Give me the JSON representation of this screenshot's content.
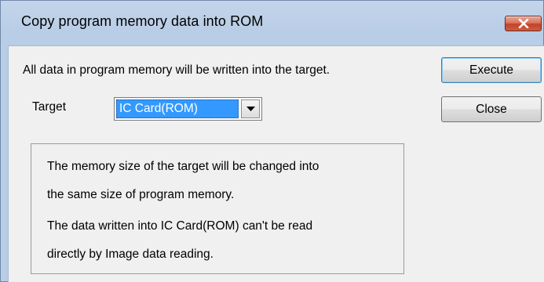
{
  "window": {
    "title": "Copy program memory data into ROM"
  },
  "description": "All data in program memory will be written into the target.",
  "target": {
    "label": "Target",
    "selected": "IC Card(ROM)"
  },
  "buttons": {
    "execute": "Execute",
    "close": "Close"
  },
  "info": {
    "line1": "The memory size of the target will be changed into",
    "line2": "the same size of program memory.",
    "line3": "The data written into IC Card(ROM) can't be read",
    "line4": "directly by Image data reading."
  },
  "colors": {
    "selection": "#3399ff",
    "close_button": "#c2432a",
    "titlebar": "#b8cde6"
  }
}
